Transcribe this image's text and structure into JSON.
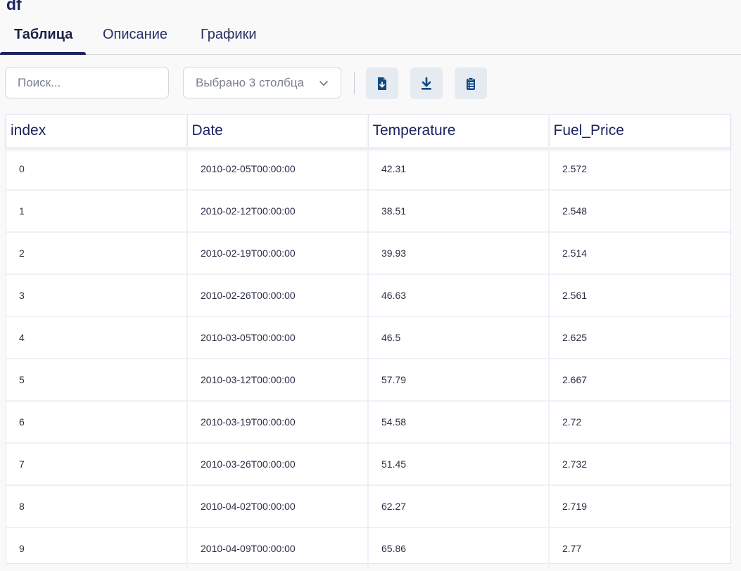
{
  "page": {
    "title": "df"
  },
  "tabs": [
    {
      "label": "Таблица"
    },
    {
      "label": "Описание"
    },
    {
      "label": "Графики"
    }
  ],
  "toolbar": {
    "search_placeholder": "Поиск...",
    "columns_select": "Выбрано 3 столбца",
    "buttons": [
      "file-download-icon",
      "download-icon",
      "clipboard-list-icon"
    ]
  },
  "table": {
    "columns": [
      "index",
      "Date",
      "Temperature",
      "Fuel_Price"
    ],
    "rows": [
      [
        "0",
        "2010-02-05T00:00:00",
        "42.31",
        "2.572"
      ],
      [
        "1",
        "2010-02-12T00:00:00",
        "38.51",
        "2.548"
      ],
      [
        "2",
        "2010-02-19T00:00:00",
        "39.93",
        "2.514"
      ],
      [
        "3",
        "2010-02-26T00:00:00",
        "46.63",
        "2.561"
      ],
      [
        "4",
        "2010-03-05T00:00:00",
        "46.5",
        "2.625"
      ],
      [
        "5",
        "2010-03-12T00:00:00",
        "57.79",
        "2.667"
      ],
      [
        "6",
        "2010-03-19T00:00:00",
        "54.58",
        "2.72"
      ],
      [
        "7",
        "2010-03-26T00:00:00",
        "51.45",
        "2.732"
      ],
      [
        "8",
        "2010-04-02T00:00:00",
        "62.27",
        "2.719"
      ],
      [
        "9",
        "2010-04-09T00:00:00",
        "65.86",
        "2.77"
      ]
    ]
  },
  "colors": {
    "accent": "#1c2260",
    "button_bg": "#e6eaf1"
  }
}
